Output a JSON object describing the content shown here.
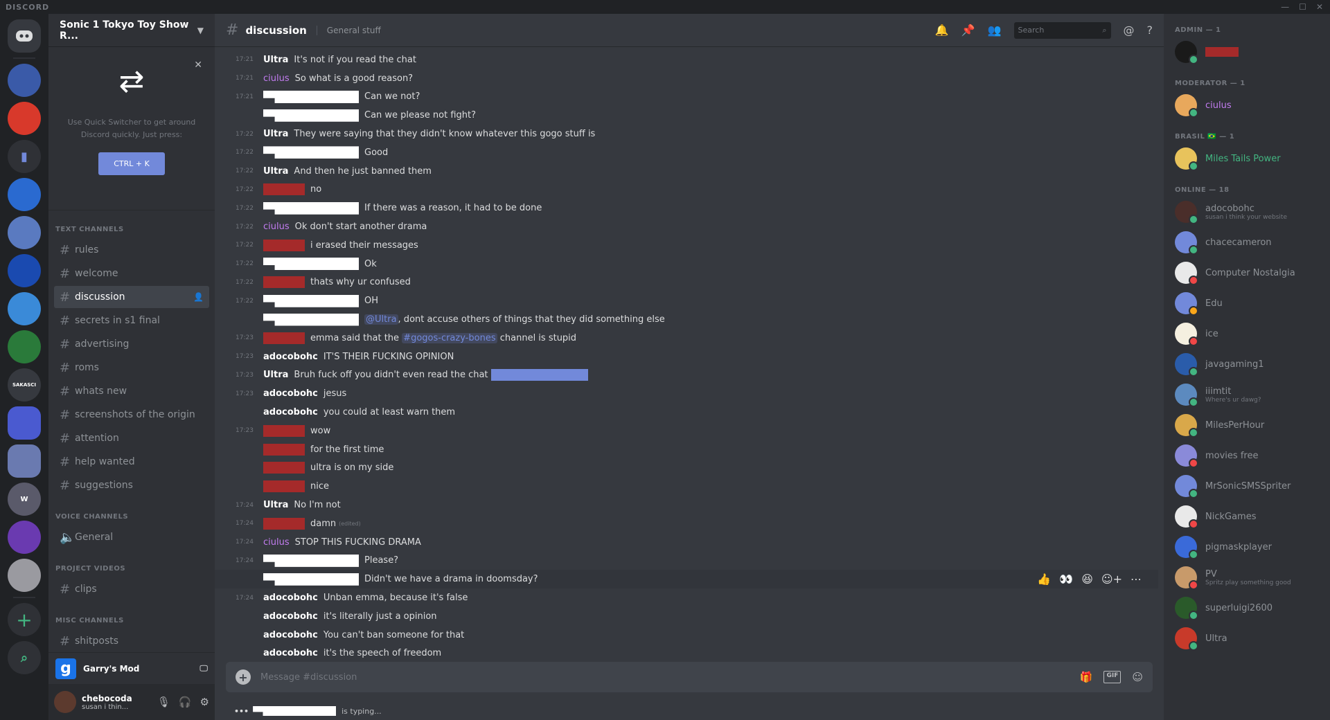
{
  "app": {
    "brand": "DISCORD"
  },
  "server": {
    "name": "Sonic 1 Tokyo Toy Show R..."
  },
  "quick_switcher": {
    "description": "Use Quick Switcher to get around Discord quickly. Just press:",
    "shortcut": "CTRL + K"
  },
  "categories": {
    "text": "TEXT CHANNELS",
    "voice": "VOICE CHANNELS",
    "project": "PROJECT VIDEOS",
    "misc": "MISC CHANNELS"
  },
  "text_channels": [
    "rules",
    "welcome",
    "discussion",
    "secrets in s1 final",
    "advertising",
    "roms",
    "whats new",
    "screenshots of the origin",
    "attention",
    "help wanted",
    "suggestions"
  ],
  "voice_channels": [
    "General"
  ],
  "project_channels": [
    "clips"
  ],
  "misc_channels": [
    "shitposts"
  ],
  "activity": {
    "game": "Garry's Mod"
  },
  "user": {
    "name": "chebocoda",
    "status": "susan i thin..."
  },
  "channel": {
    "name": "discussion",
    "topic": "General stuff"
  },
  "search": {
    "placeholder": "Search"
  },
  "messages": [
    {
      "time": "17:21",
      "author": "Ultra",
      "author_style": "white",
      "text": "It's not if you read the chat"
    },
    {
      "time": "17:21",
      "author": "ciulus",
      "author_style": "purple",
      "text": "So what is a good reason?"
    },
    {
      "time": "17:21",
      "author": "",
      "author_style": "redact-white",
      "text": "Can we not?"
    },
    {
      "time": "",
      "author": "",
      "author_style": "redact-white",
      "text": "Can we please not fight?"
    },
    {
      "time": "17:22",
      "author": "Ultra",
      "author_style": "white",
      "text": "They were saying that they didn't know whatever this gogo stuff is"
    },
    {
      "time": "17:22",
      "author": "",
      "author_style": "redact-white",
      "text": "Good"
    },
    {
      "time": "17:22",
      "author": "Ultra",
      "author_style": "white",
      "text": "And then he just banned them"
    },
    {
      "time": "17:22",
      "author": "",
      "author_style": "redact-red",
      "text": "no"
    },
    {
      "time": "17:22",
      "author": "",
      "author_style": "redact-white",
      "text": "If there was a reason, it had to be done"
    },
    {
      "time": "17:22",
      "author": "ciulus",
      "author_style": "purple",
      "text": "Ok don't start another drama"
    },
    {
      "time": "17:22",
      "author": "",
      "author_style": "redact-red",
      "text": "i erased their messages"
    },
    {
      "time": "17:22",
      "author": "",
      "author_style": "redact-white",
      "text": "Ok"
    },
    {
      "time": "17:22",
      "author": "",
      "author_style": "redact-red",
      "text": "thats why ur confused"
    },
    {
      "time": "17:22",
      "author": "",
      "author_style": "redact-white",
      "text": "OH"
    },
    {
      "time": "",
      "author": "",
      "author_style": "redact-white",
      "mention": "@Ultra",
      "text": ", dont accuse others of things that they did something else"
    },
    {
      "time": "17:23",
      "author": "",
      "author_style": "redact-red",
      "text": "emma said that the",
      "channel_link": "#gogos-crazy-bones",
      "text_after": "channel is stupid"
    },
    {
      "time": "17:23",
      "author": "adocobohc",
      "author_style": "white",
      "text": "IT'S THEIR FUCKING OPINION"
    },
    {
      "time": "17:23",
      "author": "Ultra",
      "author_style": "white",
      "text": "Bruh fuck off you didn't even read the chat",
      "blue_redact": true
    },
    {
      "time": "17:23",
      "author": "adocobohc",
      "author_style": "white",
      "text": "jesus"
    },
    {
      "time": "",
      "author": "adocobohc",
      "author_style": "white",
      "text": "you could at least warn them"
    },
    {
      "time": "17:23",
      "author": "",
      "author_style": "redact-red",
      "text": "wow"
    },
    {
      "time": "",
      "author": "",
      "author_style": "redact-red",
      "text": "for the first time"
    },
    {
      "time": "",
      "author": "",
      "author_style": "redact-red",
      "text": "ultra is on my side"
    },
    {
      "time": "",
      "author": "",
      "author_style": "redact-red",
      "text": "nice"
    },
    {
      "time": "17:24",
      "author": "Ultra",
      "author_style": "white",
      "text": "No I'm not"
    },
    {
      "time": "17:24",
      "author": "",
      "author_style": "redact-red",
      "text": "damn",
      "edited": "(edited)"
    },
    {
      "time": "17:24",
      "author": "ciulus",
      "author_style": "purple",
      "text": "STOP THIS FUCKING DRAMA"
    },
    {
      "time": "17:24",
      "author": "",
      "author_style": "redact-white",
      "text": "Please?"
    },
    {
      "time": "",
      "author": "",
      "author_style": "redact-white",
      "text": "Didn't we have a drama in doomsday?",
      "hovered": true
    },
    {
      "time": "17:24",
      "author": "adocobohc",
      "author_style": "white",
      "text": "Unban emma, because it's false"
    },
    {
      "time": "",
      "author": "adocobohc",
      "author_style": "white",
      "text": "it's literally just a opinion"
    },
    {
      "time": "",
      "author": "adocobohc",
      "author_style": "white",
      "text": "You can't ban someone for that"
    },
    {
      "time": "",
      "author": "adocobohc",
      "author_style": "white",
      "text": "it's the speech of freedom"
    }
  ],
  "composer": {
    "placeholder": "Message #discussion",
    "gif_label": "GIF"
  },
  "typing": {
    "suffix": "is typing..."
  },
  "member_groups": [
    {
      "label": "ADMIN — 1",
      "members": [
        {
          "name": "",
          "redacted": true,
          "status": "",
          "avatar": "#1a1a1a",
          "st": "#43b581"
        }
      ]
    },
    {
      "label": "MODERATOR — 1",
      "members": [
        {
          "name": "ciulus",
          "status": "",
          "avatar": "#e8a85c",
          "st": "#43b581",
          "color": "#c27cf0"
        }
      ]
    },
    {
      "label": "BRASIL 🇧🇷 — 1",
      "members": [
        {
          "name": "Miles Tails Power",
          "status": "",
          "avatar": "#e8c35c",
          "st": "#43b581",
          "color": "#43b581"
        }
      ]
    },
    {
      "label": "ONLINE — 18",
      "members": [
        {
          "name": "adocobohc",
          "status": "susan i think your website",
          "avatar": "#4a2e2a",
          "st": "#43b581"
        },
        {
          "name": "chacecameron",
          "status": "",
          "avatar": "#7289da",
          "st": "#43b581"
        },
        {
          "name": "Computer Nostalgia",
          "status": "",
          "avatar": "#e9e9e9",
          "st": "#f04747"
        },
        {
          "name": "Edu",
          "status": "",
          "avatar": "#7289da",
          "st": "#faa61a"
        },
        {
          "name": "ice",
          "status": "",
          "avatar": "#f5f0e0",
          "st": "#f04747"
        },
        {
          "name": "javagaming1",
          "status": "",
          "avatar": "#2a5caa",
          "st": "#43b581"
        },
        {
          "name": "iiimtit",
          "status": "Where's ur dawg?",
          "avatar": "#5c8abf",
          "st": "#43b581"
        },
        {
          "name": "MilesPerHour",
          "status": "",
          "avatar": "#d9a84a",
          "st": "#43b581"
        },
        {
          "name": "movies free",
          "status": "",
          "avatar": "#8a8ad9",
          "st": "#f04747"
        },
        {
          "name": "MrSonicSMSSpriter",
          "status": "",
          "avatar": "#7289da",
          "st": "#43b581"
        },
        {
          "name": "NickGames",
          "status": "",
          "avatar": "#e9e9e9",
          "st": "#f04747"
        },
        {
          "name": "pigmaskplayer",
          "status": "",
          "avatar": "#3a6ad9",
          "st": "#43b581"
        },
        {
          "name": "PV",
          "status": "Spritz play something good",
          "avatar": "#c89a6a",
          "st": "#f04747"
        },
        {
          "name": "superluigi2600",
          "status": "",
          "avatar": "#2a5a2a",
          "st": "#43b581"
        },
        {
          "name": "Ultra",
          "status": "",
          "avatar": "#c83a2a",
          "st": "#43b581"
        }
      ]
    }
  ]
}
